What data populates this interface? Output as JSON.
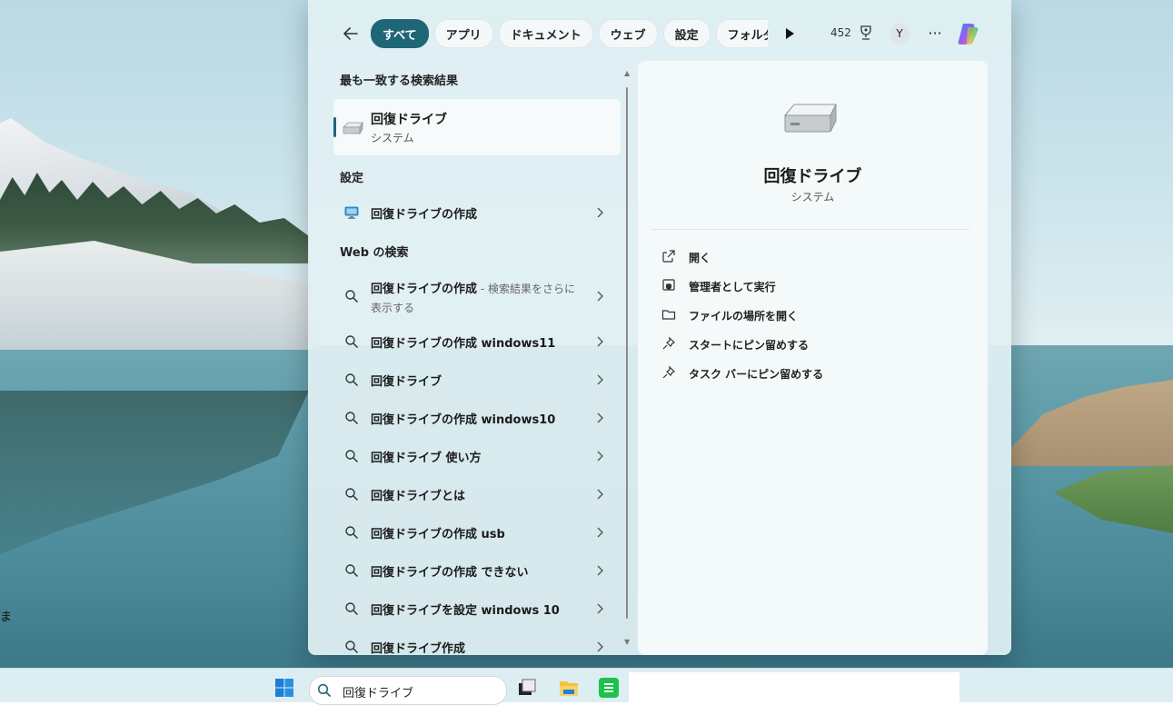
{
  "colors": {
    "accent": "#1f6677",
    "panel_bg": "#e1f0f3"
  },
  "header": {
    "back_icon": "arrow-left-icon",
    "chips": [
      "すべて",
      "アプリ",
      "ドキュメント",
      "ウェブ",
      "設定",
      "フォルダー"
    ],
    "points": "452",
    "avatar_initial": "Y",
    "more": "···"
  },
  "best_match": {
    "heading": "最も一致する検索結果",
    "title": "回復ドライブ",
    "subtitle": "システム"
  },
  "settings": {
    "heading": "設定",
    "item": "回復ドライブの作成"
  },
  "web": {
    "heading": "Web の検索",
    "first": {
      "label": "回復ドライブの作成",
      "suffix": " - 検索結果をさらに表示する"
    },
    "items": [
      "回復ドライブの作成 windows11",
      "回復ドライブ",
      "回復ドライブの作成 windows10",
      "回復ドライブ 使い方",
      "回復ドライブとは",
      "回復ドライブの作成 usb",
      "回復ドライブの作成 できない",
      "回復ドライブを設定 windows 10",
      "回復ドライブ作成"
    ]
  },
  "detail": {
    "title": "回復ドライブ",
    "subtitle": "システム",
    "actions": [
      "開く",
      "管理者として実行",
      "ファイルの場所を開く",
      "スタートにピン留めする",
      "タスク バーにピン留めする"
    ]
  },
  "taskbar": {
    "search_text": "回復ドライブ"
  },
  "wallpaper": {
    "edge_char": "ま"
  }
}
